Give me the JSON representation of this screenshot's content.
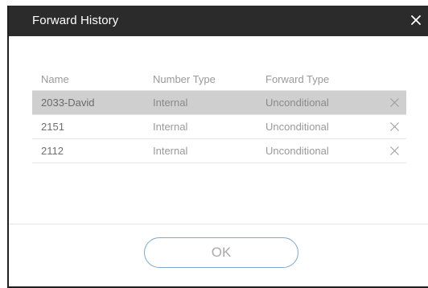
{
  "dialog": {
    "title": "Forward History",
    "close_icon": "close-icon",
    "ok_label": "OK"
  },
  "table": {
    "columns": [
      "Name",
      "Number Type",
      "Forward Type"
    ],
    "rows": [
      {
        "name": "2033-David",
        "number_type": "Internal",
        "forward_type": "Unconditional",
        "selected": true
      },
      {
        "name": "2151",
        "number_type": "Internal",
        "forward_type": "Unconditional",
        "selected": false
      },
      {
        "name": "2112",
        "number_type": "Internal",
        "forward_type": "Unconditional",
        "selected": false
      }
    ],
    "delete_icon": "delete-icon"
  },
  "colors": {
    "title_bar": "#2b2b2b",
    "selected_row": "#cfcfcf",
    "ok_border": "#7fa9c9"
  }
}
